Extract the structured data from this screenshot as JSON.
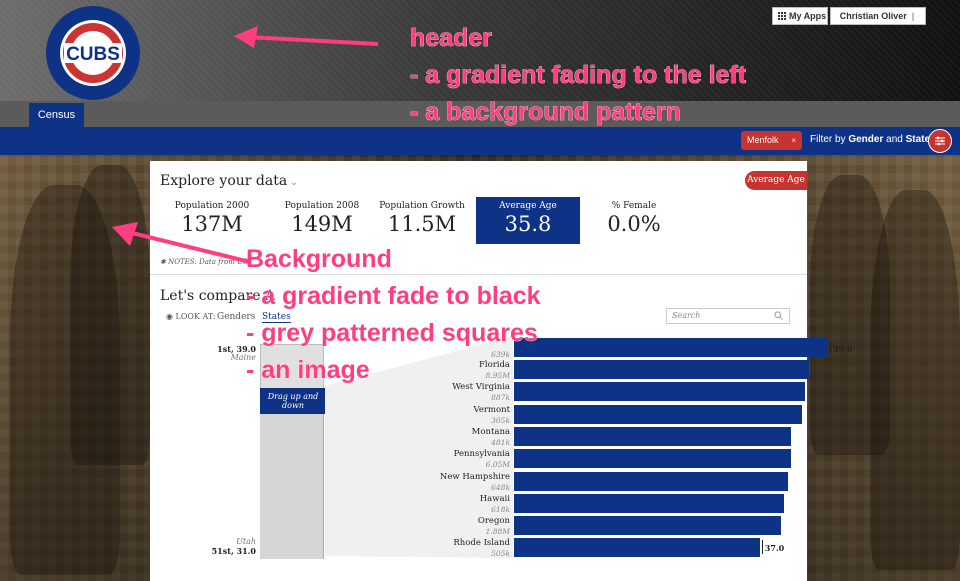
{
  "header": {
    "logo_text": "CUBS",
    "my_apps": "My Apps",
    "user_name": "Christian Oliver",
    "user_sep": "|"
  },
  "tabs": [
    {
      "label": "Census"
    }
  ],
  "filterbar": {
    "chip": "Menfolk",
    "chip_close": "×",
    "prefix": "Filter by ",
    "gender": "Gender",
    "and": " and ",
    "state": "State"
  },
  "panel": {
    "explore_title": "Explore your data",
    "avg_age_button": "Average Age",
    "stats": [
      {
        "label": "Population 2000",
        "value": "137M"
      },
      {
        "label": "Population 2008",
        "value": "149M"
      },
      {
        "label": "Population Growth",
        "value": "11.5M"
      },
      {
        "label": "Average Age",
        "value": "35.8"
      },
      {
        "label": "% Female",
        "value": "0.0%"
      }
    ],
    "notes": "✱ NOTES: Data from US",
    "compare_prefix": "Let's compare ",
    "compare_highlight": "A",
    "look_at": "◉ LOOK AT:",
    "look_tabs": [
      "Genders",
      "States"
    ],
    "search_placeholder": "Search",
    "rank_top": "1st, 39.0",
    "rank_top_state": "Maine",
    "rank_bottom_state": "Utah",
    "rank_bottom": "51st, 31.0",
    "drag_tip": "Drag up and down"
  },
  "bars": {
    "top_sub": "639k",
    "top_value": "39.0",
    "bottom_value": "37.0",
    "items": [
      {
        "state": "Florida",
        "sub": "8.95M",
        "value": 38.4
      },
      {
        "state": "West Virginia",
        "sub": "887k",
        "value": 38.3
      },
      {
        "state": "Vermont",
        "sub": "305k",
        "value": 38.2
      },
      {
        "state": "Montana",
        "sub": "481k",
        "value": 37.9
      },
      {
        "state": "Pennsylvania",
        "sub": "6.05M",
        "value": 37.9
      },
      {
        "state": "New Hampshire",
        "sub": "648k",
        "value": 37.8
      },
      {
        "state": "Hawaii",
        "sub": "618k",
        "value": 37.7
      },
      {
        "state": "Oregon",
        "sub": "1.88M",
        "value": 37.6
      },
      {
        "state": "Rhode Island",
        "sub": "505k",
        "value": 37.0
      }
    ],
    "first_value": 39.0
  },
  "annotations": {
    "header_title": "header",
    "header_1": "- a gradient fading to the left",
    "header_2": "- a background pattern",
    "bg_title": "Background",
    "bg_1": "- a gradient fade to black",
    "bg_2": "- grey patterned squares",
    "bg_3": "- an image"
  },
  "colors": {
    "brand_blue": "#0e3386",
    "brand_red": "#c7332f",
    "annotation_pink": "#ff3d7f"
  }
}
